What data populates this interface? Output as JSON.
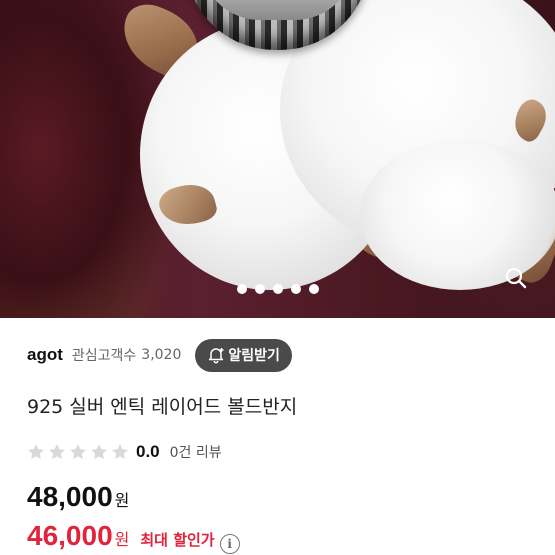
{
  "gallery": {
    "page_count": 5,
    "active_index": 0,
    "zoom_icon": "magnifier-icon"
  },
  "seller": {
    "name": "agot",
    "follower_label": "관심고객수",
    "follower_count": "3,020",
    "alert_button_label": "알림받기",
    "alert_icon": "bell-plus-icon"
  },
  "product": {
    "title": "925 실버 엔틱 레이어드 볼드반지"
  },
  "rating": {
    "stars_filled": 0,
    "stars_total": 5,
    "value": "0.0",
    "review_count_text": "0건 리뷰"
  },
  "price": {
    "original": "48,000",
    "original_unit": "원",
    "sale": "46,000",
    "sale_unit": "원",
    "discount_label": "최대 할인가",
    "info_icon": "info-icon"
  },
  "colors": {
    "sale_red": "#e0243c",
    "button_dark": "#4a4a4a",
    "star_empty": "#d9d9d9"
  }
}
